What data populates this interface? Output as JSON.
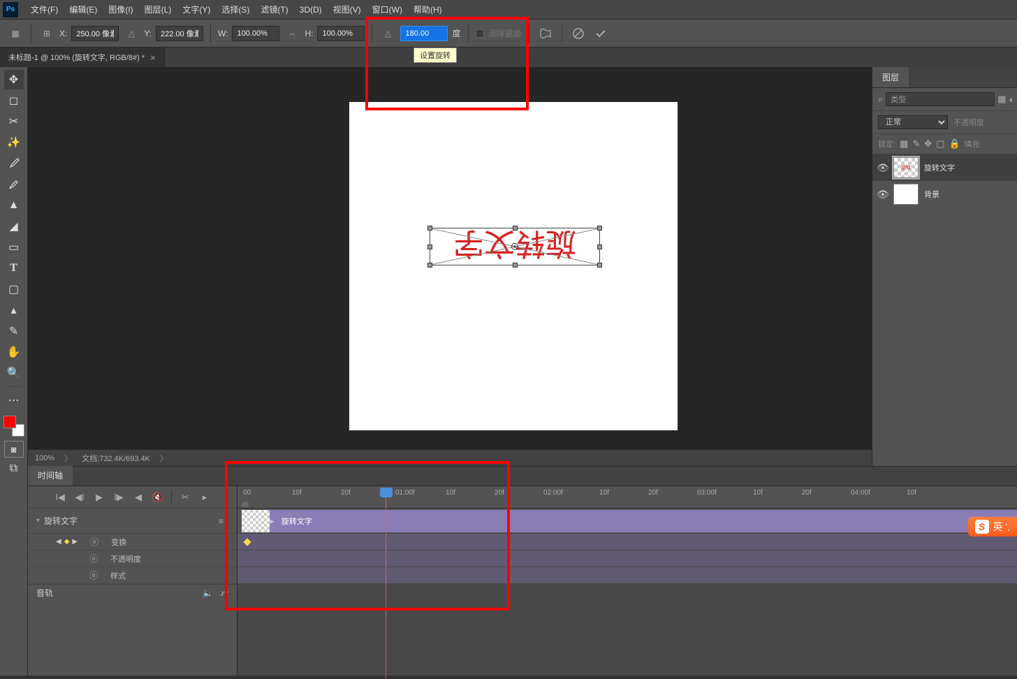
{
  "menu": {
    "items": [
      "文件(F)",
      "编辑(E)",
      "图像(I)",
      "图层(L)",
      "文字(Y)",
      "选择(S)",
      "滤镜(T)",
      "3D(D)",
      "视图(V)",
      "窗口(W)",
      "帮助(H)"
    ]
  },
  "options": {
    "x_label": "X:",
    "x_value": "250.00 像素",
    "y_label": "Y:",
    "y_value": "222.00 像素",
    "w_label": "W:",
    "w_value": "100.00%",
    "h_label": "H:",
    "h_value": "100.00%",
    "angle_value": "180.00",
    "angle_unit": "度",
    "antialias": "消除锯齿"
  },
  "tooltip": "设置旋转",
  "tab": {
    "title": "未标题-1 @ 100% (旋转文字, RGB/8#) *"
  },
  "canvas": {
    "text": "旋转文字"
  },
  "status": {
    "zoom": "100%",
    "doc_info": "文档:732.4K/693.4K"
  },
  "layers": {
    "panel_title": "图层",
    "filter_placeholder": "类型",
    "blend_mode": "正常",
    "opacity_label": "不透明度",
    "lock_label": "锁定:",
    "fill_label": "填充",
    "items": [
      {
        "name": "旋转文字",
        "selected": true
      },
      {
        "name": "背景",
        "selected": false
      }
    ]
  },
  "timeline": {
    "tab_title": "时间轴",
    "layer_name": "旋转文字",
    "props": [
      "变换",
      "不透明度",
      "样式"
    ],
    "audio": "音轨",
    "ruler": [
      "00",
      "10f",
      "20f",
      "01:00f",
      "10f",
      "20f",
      "02:00f",
      "10f",
      "20f",
      "03:00f",
      "10f",
      "20f",
      "04:00f",
      "10f"
    ],
    "clip_label": "旋转文字"
  },
  "ime": {
    "text": "英 ',"
  }
}
